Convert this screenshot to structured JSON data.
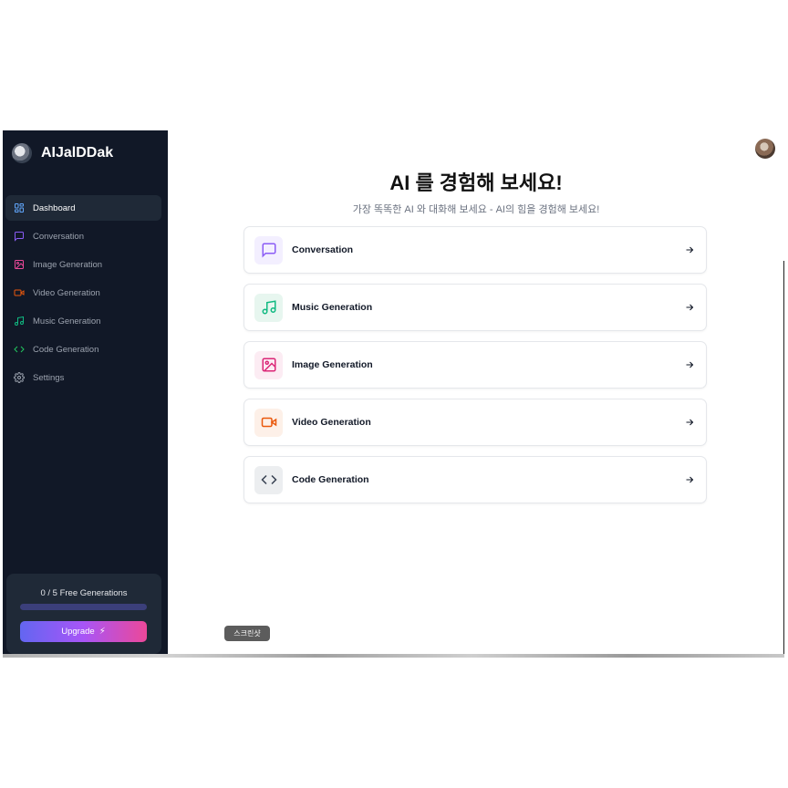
{
  "app": {
    "name": "AIJalDDak"
  },
  "sidebar": {
    "items": [
      {
        "label": "Dashboard",
        "icon": "dashboard-icon",
        "color": "#60a5fa",
        "active": true
      },
      {
        "label": "Conversation",
        "icon": "message-square-icon",
        "color": "#8b5cf6",
        "active": false
      },
      {
        "label": "Image Generation",
        "icon": "image-icon",
        "color": "#ec4899",
        "active": false
      },
      {
        "label": "Video Generation",
        "icon": "video-icon",
        "color": "#ea580c",
        "active": false
      },
      {
        "label": "Music Generation",
        "icon": "music-icon",
        "color": "#10b981",
        "active": false
      },
      {
        "label": "Code Generation",
        "icon": "code-icon",
        "color": "#22c55e",
        "active": false
      },
      {
        "label": "Settings",
        "icon": "gear-icon",
        "color": "#9ca3af",
        "active": false
      }
    ]
  },
  "free_generations": {
    "label": "0 / 5 Free Generations",
    "progress": 0.0
  },
  "upgrade": {
    "label": "Upgrade"
  },
  "main": {
    "title": "AI 를 경험해 보세요!",
    "subtitle": "가장 똑똑한 AI 와 대화해 보세요 - AI의 힘을 경험해 보세요!",
    "cards": [
      {
        "label": "Conversation",
        "icon": "message-square-icon",
        "color": "#8b5cf6",
        "bg": "#f3efff"
      },
      {
        "label": "Music Generation",
        "icon": "music-icon",
        "color": "#10b981",
        "bg": "#e7f6ef"
      },
      {
        "label": "Image Generation",
        "icon": "image-icon",
        "color": "#db2777",
        "bg": "#fcecf3"
      },
      {
        "label": "Video Generation",
        "icon": "video-icon",
        "color": "#ea580c",
        "bg": "#fdf0e8"
      },
      {
        "label": "Code Generation",
        "icon": "code-icon",
        "color": "#374151",
        "bg": "#eceef0"
      }
    ]
  },
  "tooltip": {
    "label": "스크린샷"
  }
}
